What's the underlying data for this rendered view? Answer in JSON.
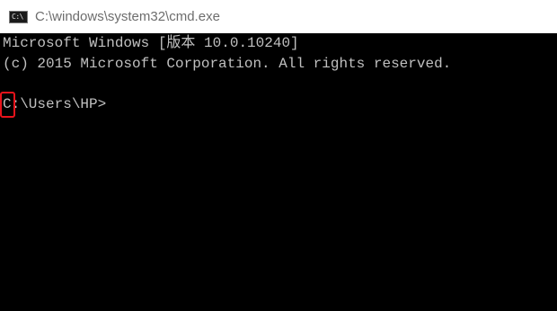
{
  "window": {
    "title": "C:\\windows\\system32\\cmd.exe",
    "icon_text": "C:\\"
  },
  "console": {
    "lines": [
      "Microsoft Windows [版本 10.0.10240]",
      "(c) 2015 Microsoft Corporation. All rights reserved.",
      "",
      "C:\\Users\\HP>"
    ]
  },
  "colors": {
    "background": "#000000",
    "text": "#c0c0c0",
    "highlight": "#e8131b",
    "titlebar": "#ffffff"
  }
}
